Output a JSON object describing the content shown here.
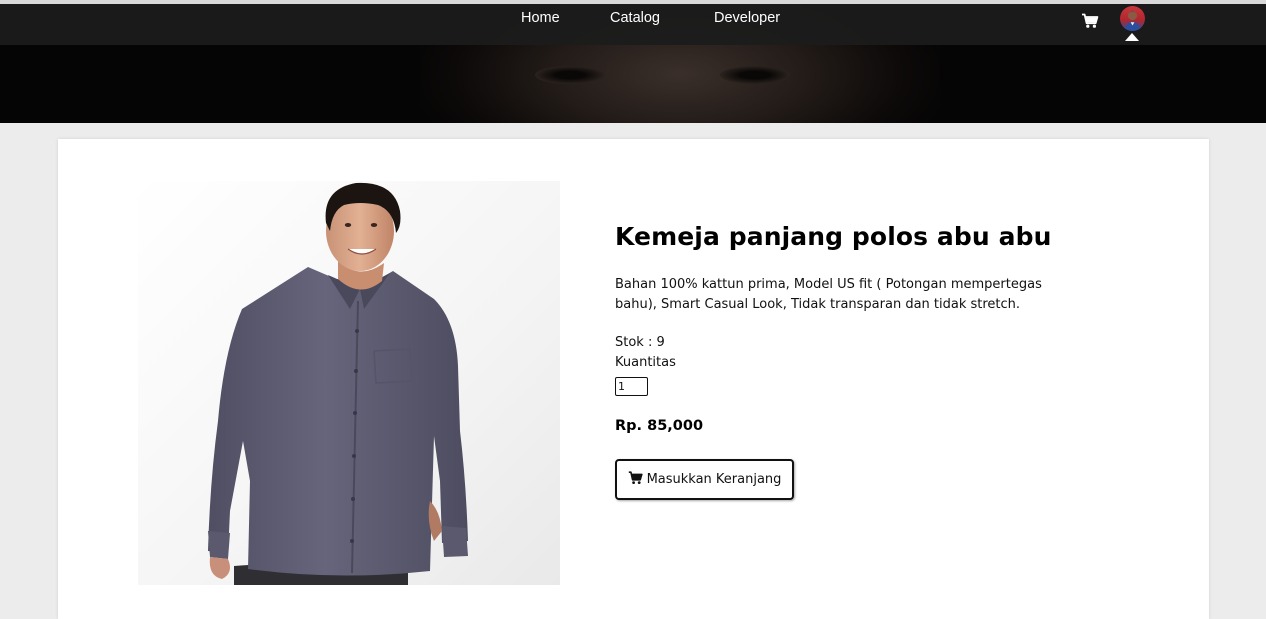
{
  "nav": {
    "links": [
      "Home",
      "Catalog",
      "Developer"
    ],
    "cart_icon": "cart-icon",
    "avatar_icon": "user-avatar"
  },
  "product": {
    "title": "Kemeja panjang polos abu abu",
    "description": "Bahan 100% kattun prima, Model US fit ( Potongan mempertegas bahu), Smart Casual Look, Tidak transparan dan tidak stretch.",
    "stock_text": "Stok : 9",
    "quantity_label": "Kuantitas",
    "quantity_value": "1",
    "price": "Rp. 85,000",
    "add_to_cart_label": "Masukkan Keranjang",
    "image_icon": "product-photo-shirt"
  },
  "colors": {
    "navbar": "#1c1c1c",
    "shirt": "#5c5b70",
    "accent": "#000000"
  }
}
